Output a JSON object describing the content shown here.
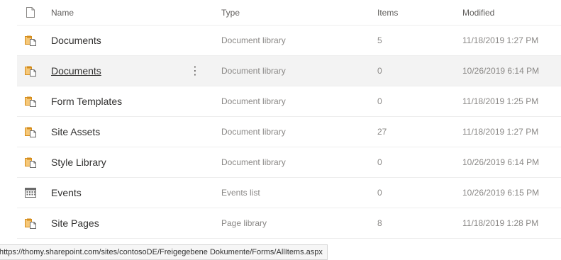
{
  "header": {
    "name": "Name",
    "type": "Type",
    "items": "Items",
    "modified": "Modified",
    "icon": "file-icon"
  },
  "rows": [
    {
      "icon": "document-library-icon",
      "name": "Documents",
      "type": "Document library",
      "items": "5",
      "modified": "11/18/2019 1:27 PM"
    },
    {
      "icon": "document-library-icon",
      "name": "Documents",
      "type": "Document library",
      "items": "0",
      "modified": "10/26/2019 6:14 PM",
      "more": "⋮"
    },
    {
      "icon": "document-library-icon",
      "name": "Form Templates",
      "type": "Document library",
      "items": "0",
      "modified": "11/18/2019 1:25 PM"
    },
    {
      "icon": "document-library-icon",
      "name": "Site Assets",
      "type": "Document library",
      "items": "27",
      "modified": "11/18/2019 1:27 PM"
    },
    {
      "icon": "document-library-icon",
      "name": "Style Library",
      "type": "Document library",
      "items": "0",
      "modified": "10/26/2019 6:14 PM"
    },
    {
      "icon": "events-calendar-icon",
      "name": "Events",
      "type": "Events list",
      "items": "0",
      "modified": "10/26/2019 6:15 PM"
    },
    {
      "icon": "document-library-icon",
      "name": "Site Pages",
      "type": "Page library",
      "items": "8",
      "modified": "11/18/2019 1:28 PM"
    }
  ],
  "status_url": "https://thomy.sharepoint.com/sites/contosoDE/Freigegebene Dokumente/Forms/AllItems.aspx",
  "colors": {
    "library_icon_orange": "#e8a33d",
    "selected_row_bg": "#f3f3f3"
  }
}
